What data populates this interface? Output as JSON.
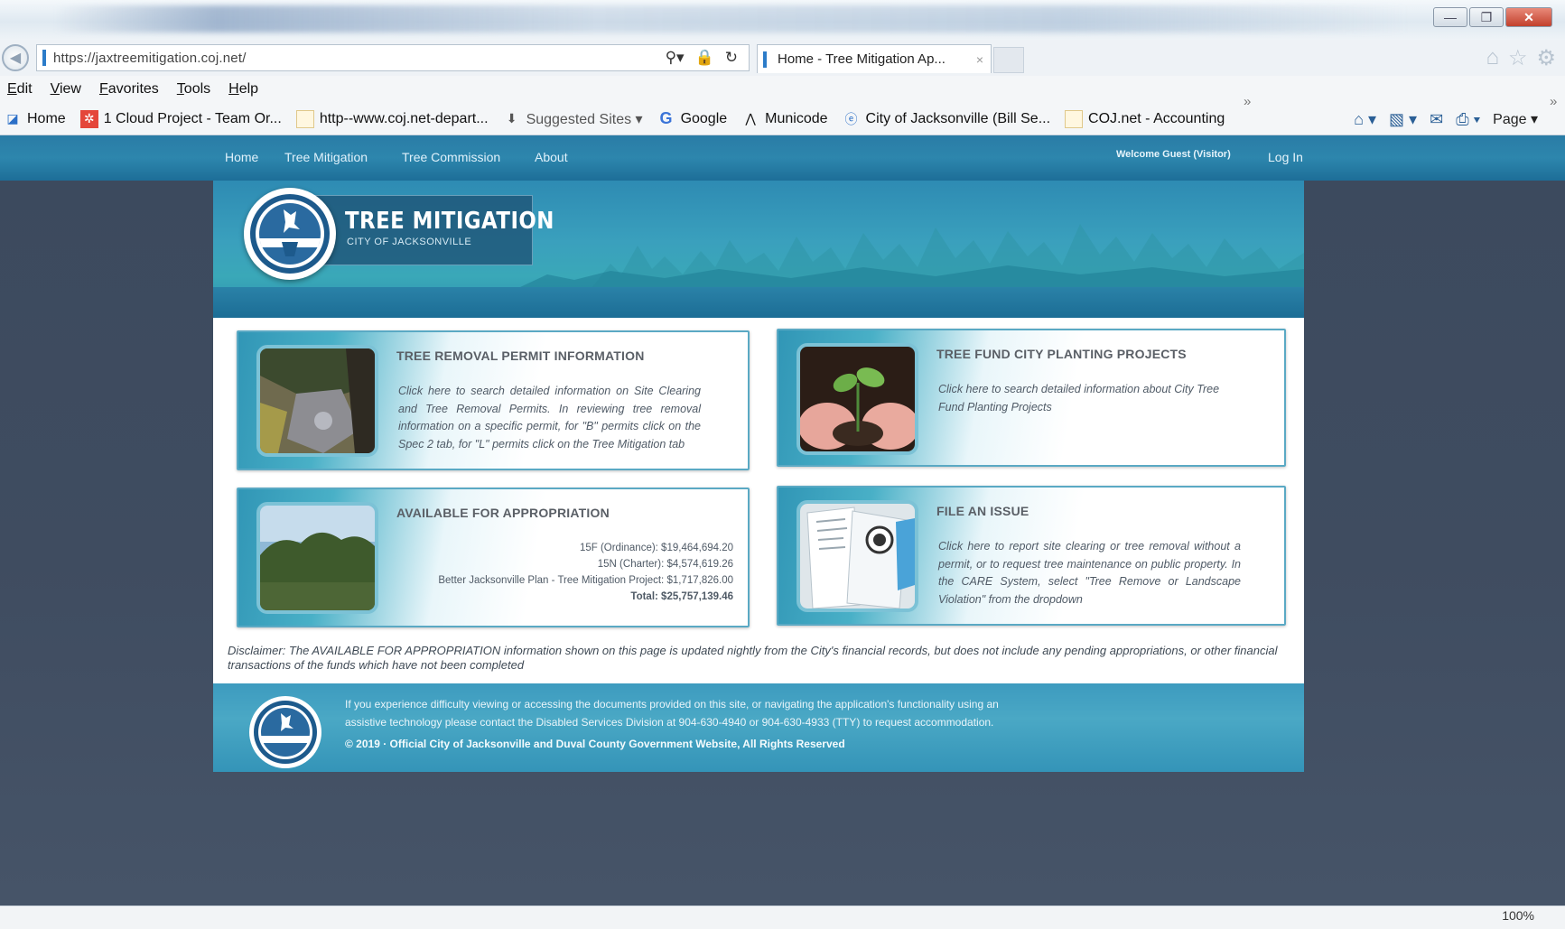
{
  "browser": {
    "address": "https://jaxtreemitigation.coj.net/",
    "tab_title": "Home - Tree Mitigation Ap...",
    "tab_close": "×",
    "menu": [
      "Edit",
      "View",
      "Favorites",
      "Tools",
      "Help"
    ],
    "favorites": [
      {
        "label": "Home",
        "icon": "home-favicon"
      },
      {
        "label": "1 Cloud Project - Team Or...",
        "icon": "cloud-favicon"
      },
      {
        "label": "http--www.coj.net-depart...",
        "icon": "page-favicon"
      },
      {
        "label": "Suggested Sites ▾",
        "icon": "suggested-sites-icon"
      },
      {
        "label": "Google",
        "icon": "google-icon"
      },
      {
        "label": "Municode",
        "icon": "municode-icon"
      },
      {
        "label": "City of Jacksonville (Bill Se...",
        "icon": "ie-icon"
      },
      {
        "label": "COJ.net - Accounting",
        "icon": "page-favicon"
      }
    ],
    "command_page": "Page ▾",
    "zoom": "100%",
    "chevron": "»"
  },
  "site": {
    "nav": [
      "Home",
      "Tree Mitigation",
      "Tree Commission",
      "About"
    ],
    "welcome": "Welcome Guest (Visitor)",
    "login": "Log In",
    "logo_title": "TREE MITIGATION",
    "logo_subtitle": "CITY OF JACKSONVILLE"
  },
  "cards": {
    "removal": {
      "title": "TREE REMOVAL PERMIT INFORMATION",
      "text": "Click here to search detailed information on Site Clearing and Tree Removal Permits. In reviewing tree removal information on a specific permit, for \"B\" permits click on the Spec 2 tab, for \"L\" permits click on the Tree Mitigation tab"
    },
    "fund": {
      "title": "TREE FUND CITY PLANTING PROJECTS",
      "text": "Click here to search detailed information about City Tree Fund Planting Projects"
    },
    "appropriation": {
      "title": "AVAILABLE FOR APPROPRIATION",
      "lines": [
        "15F (Ordinance): $19,464,694.20",
        "15N (Charter): $4,574,619.26",
        "Better Jacksonville Plan - Tree Mitigation Project: $1,717,826.00",
        "Total: $25,757,139.46"
      ]
    },
    "issue": {
      "title": "FILE AN ISSUE",
      "text": "Click here to report site clearing or tree removal without a permit, or to request tree maintenance on public property. In the CARE System, select \"Tree Remove or Landscape Violation\" from the dropdown"
    }
  },
  "disclaimer": "Disclaimer: The AVAILABLE FOR APPROPRIATION information shown on this page is updated nightly from the City's financial records, but does not include any pending appropriations, or other financial transactions of the funds which have not been completed",
  "footer": {
    "line1": "If you experience difficulty viewing or accessing the documents provided on this site, or navigating the application's functionality using an",
    "line2": "assistive technology please contact the Disabled Services Division at 904-630-4940 or 904-630-4933 (TTY) to request accommodation.",
    "line3": "© 2019 · Official City of Jacksonville and Duval County Government Website, All Rights Reserved"
  }
}
